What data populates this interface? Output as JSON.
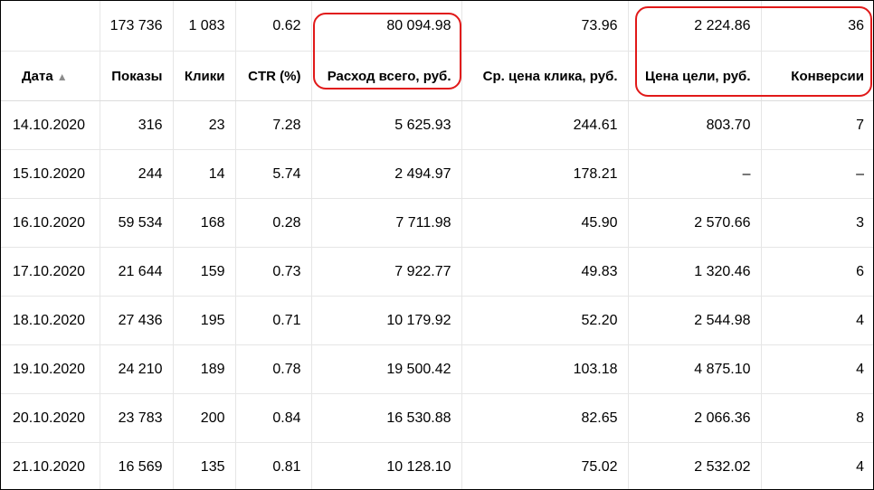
{
  "totals": {
    "date": "",
    "impressions": "173 736",
    "clicks": "1 083",
    "ctr": "0.62",
    "spend": "80 094.98",
    "cpc": "73.96",
    "goal_cost": "2 224.86",
    "conversions": "36"
  },
  "headers": {
    "date": "Дата",
    "date_sort_icon": "▲",
    "impressions": "Показы",
    "clicks": "Клики",
    "ctr": "CTR (%)",
    "spend": "Расход всего, руб.",
    "cpc": "Ср. цена клика, руб.",
    "goal_cost": "Цена цели, руб.",
    "conversions": "Конверсии"
  },
  "rows": [
    {
      "date": "14.10.2020",
      "impressions": "316",
      "clicks": "23",
      "ctr": "7.28",
      "spend": "5 625.93",
      "cpc": "244.61",
      "goal_cost": "803.70",
      "conversions": "7"
    },
    {
      "date": "15.10.2020",
      "impressions": "244",
      "clicks": "14",
      "ctr": "5.74",
      "spend": "2 494.97",
      "cpc": "178.21",
      "goal_cost": "–",
      "conversions": "–"
    },
    {
      "date": "16.10.2020",
      "impressions": "59 534",
      "clicks": "168",
      "ctr": "0.28",
      "spend": "7 711.98",
      "cpc": "45.90",
      "goal_cost": "2 570.66",
      "conversions": "3"
    },
    {
      "date": "17.10.2020",
      "impressions": "21 644",
      "clicks": "159",
      "ctr": "0.73",
      "spend": "7 922.77",
      "cpc": "49.83",
      "goal_cost": "1 320.46",
      "conversions": "6"
    },
    {
      "date": "18.10.2020",
      "impressions": "27 436",
      "clicks": "195",
      "ctr": "0.71",
      "spend": "10 179.92",
      "cpc": "52.20",
      "goal_cost": "2 544.98",
      "conversions": "4"
    },
    {
      "date": "19.10.2020",
      "impressions": "24 210",
      "clicks": "189",
      "ctr": "0.78",
      "spend": "19 500.42",
      "cpc": "103.18",
      "goal_cost": "4 875.10",
      "conversions": "4"
    },
    {
      "date": "20.10.2020",
      "impressions": "23 783",
      "clicks": "200",
      "ctr": "0.84",
      "spend": "16 530.88",
      "cpc": "82.65",
      "goal_cost": "2 066.36",
      "conversions": "8"
    },
    {
      "date": "21.10.2020",
      "impressions": "16 569",
      "clicks": "135",
      "ctr": "0.81",
      "spend": "10 128.10",
      "cpc": "75.02",
      "goal_cost": "2 532.02",
      "conversions": "4"
    }
  ],
  "colors": {
    "highlight": "#e11919",
    "grid": "#e6e6e6",
    "sort_icon": "#8c8c8c"
  }
}
